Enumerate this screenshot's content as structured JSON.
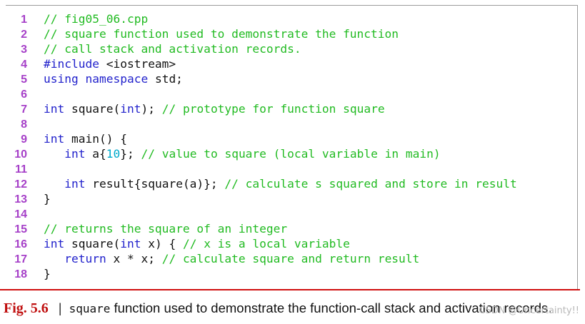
{
  "code": {
    "lines": [
      {
        "n": "1",
        "tokens": [
          {
            "c": "comment",
            "t": "// fig05_06.cpp"
          }
        ]
      },
      {
        "n": "2",
        "tokens": [
          {
            "c": "comment",
            "t": "// square function used to demonstrate the function"
          }
        ]
      },
      {
        "n": "3",
        "tokens": [
          {
            "c": "comment",
            "t": "// call stack and activation records."
          }
        ]
      },
      {
        "n": "4",
        "tokens": [
          {
            "c": "pp",
            "t": "#include"
          },
          {
            "c": "plain",
            "t": " <iostream>"
          }
        ]
      },
      {
        "n": "5",
        "tokens": [
          {
            "c": "kw",
            "t": "using"
          },
          {
            "c": "plain",
            "t": " "
          },
          {
            "c": "kw",
            "t": "namespace"
          },
          {
            "c": "plain",
            "t": " std;"
          }
        ]
      },
      {
        "n": "6",
        "tokens": []
      },
      {
        "n": "7",
        "tokens": [
          {
            "c": "kw",
            "t": "int"
          },
          {
            "c": "plain",
            "t": " square("
          },
          {
            "c": "kw",
            "t": "int"
          },
          {
            "c": "plain",
            "t": "); "
          },
          {
            "c": "comment",
            "t": "// prototype for function square"
          }
        ]
      },
      {
        "n": "8",
        "tokens": []
      },
      {
        "n": "9",
        "tokens": [
          {
            "c": "kw",
            "t": "int"
          },
          {
            "c": "plain",
            "t": " main() {"
          }
        ]
      },
      {
        "n": "10",
        "tokens": [
          {
            "c": "plain",
            "t": "   "
          },
          {
            "c": "kw",
            "t": "int"
          },
          {
            "c": "plain",
            "t": " a{"
          },
          {
            "c": "num",
            "t": "10"
          },
          {
            "c": "plain",
            "t": "}; "
          },
          {
            "c": "comment",
            "t": "// value to square (local variable in main)"
          }
        ]
      },
      {
        "n": "11",
        "tokens": []
      },
      {
        "n": "12",
        "tokens": [
          {
            "c": "plain",
            "t": "   "
          },
          {
            "c": "kw",
            "t": "int"
          },
          {
            "c": "plain",
            "t": " result{square(a)}; "
          },
          {
            "c": "comment",
            "t": "// calculate s squared and store in result"
          }
        ]
      },
      {
        "n": "13",
        "tokens": [
          {
            "c": "plain",
            "t": "}"
          }
        ]
      },
      {
        "n": "14",
        "tokens": []
      },
      {
        "n": "15",
        "tokens": [
          {
            "c": "comment",
            "t": "// returns the square of an integer"
          }
        ]
      },
      {
        "n": "16",
        "tokens": [
          {
            "c": "kw",
            "t": "int"
          },
          {
            "c": "plain",
            "t": " square("
          },
          {
            "c": "kw",
            "t": "int"
          },
          {
            "c": "plain",
            "t": " x) { "
          },
          {
            "c": "comment",
            "t": "// x is a local variable"
          }
        ]
      },
      {
        "n": "17",
        "tokens": [
          {
            "c": "plain",
            "t": "   "
          },
          {
            "c": "kw",
            "t": "return"
          },
          {
            "c": "plain",
            "t": " x * x; "
          },
          {
            "c": "comment",
            "t": "// calculate square and return result"
          }
        ]
      },
      {
        "n": "18",
        "tokens": [
          {
            "c": "plain",
            "t": "}"
          }
        ]
      }
    ]
  },
  "caption": {
    "label": "Fig. 5.6",
    "separator": "|",
    "code_word": "square",
    "text": " function used to demonstrate the function-call stack and activation records."
  },
  "watermark": "CSDN @Uncertainty!!",
  "colors": {
    "line_number": "#a640c8",
    "comment": "#22bb22",
    "keyword": "#2222cc",
    "number": "#00aacc",
    "caption_label": "#c01010",
    "caption_rule": "#d01010"
  }
}
